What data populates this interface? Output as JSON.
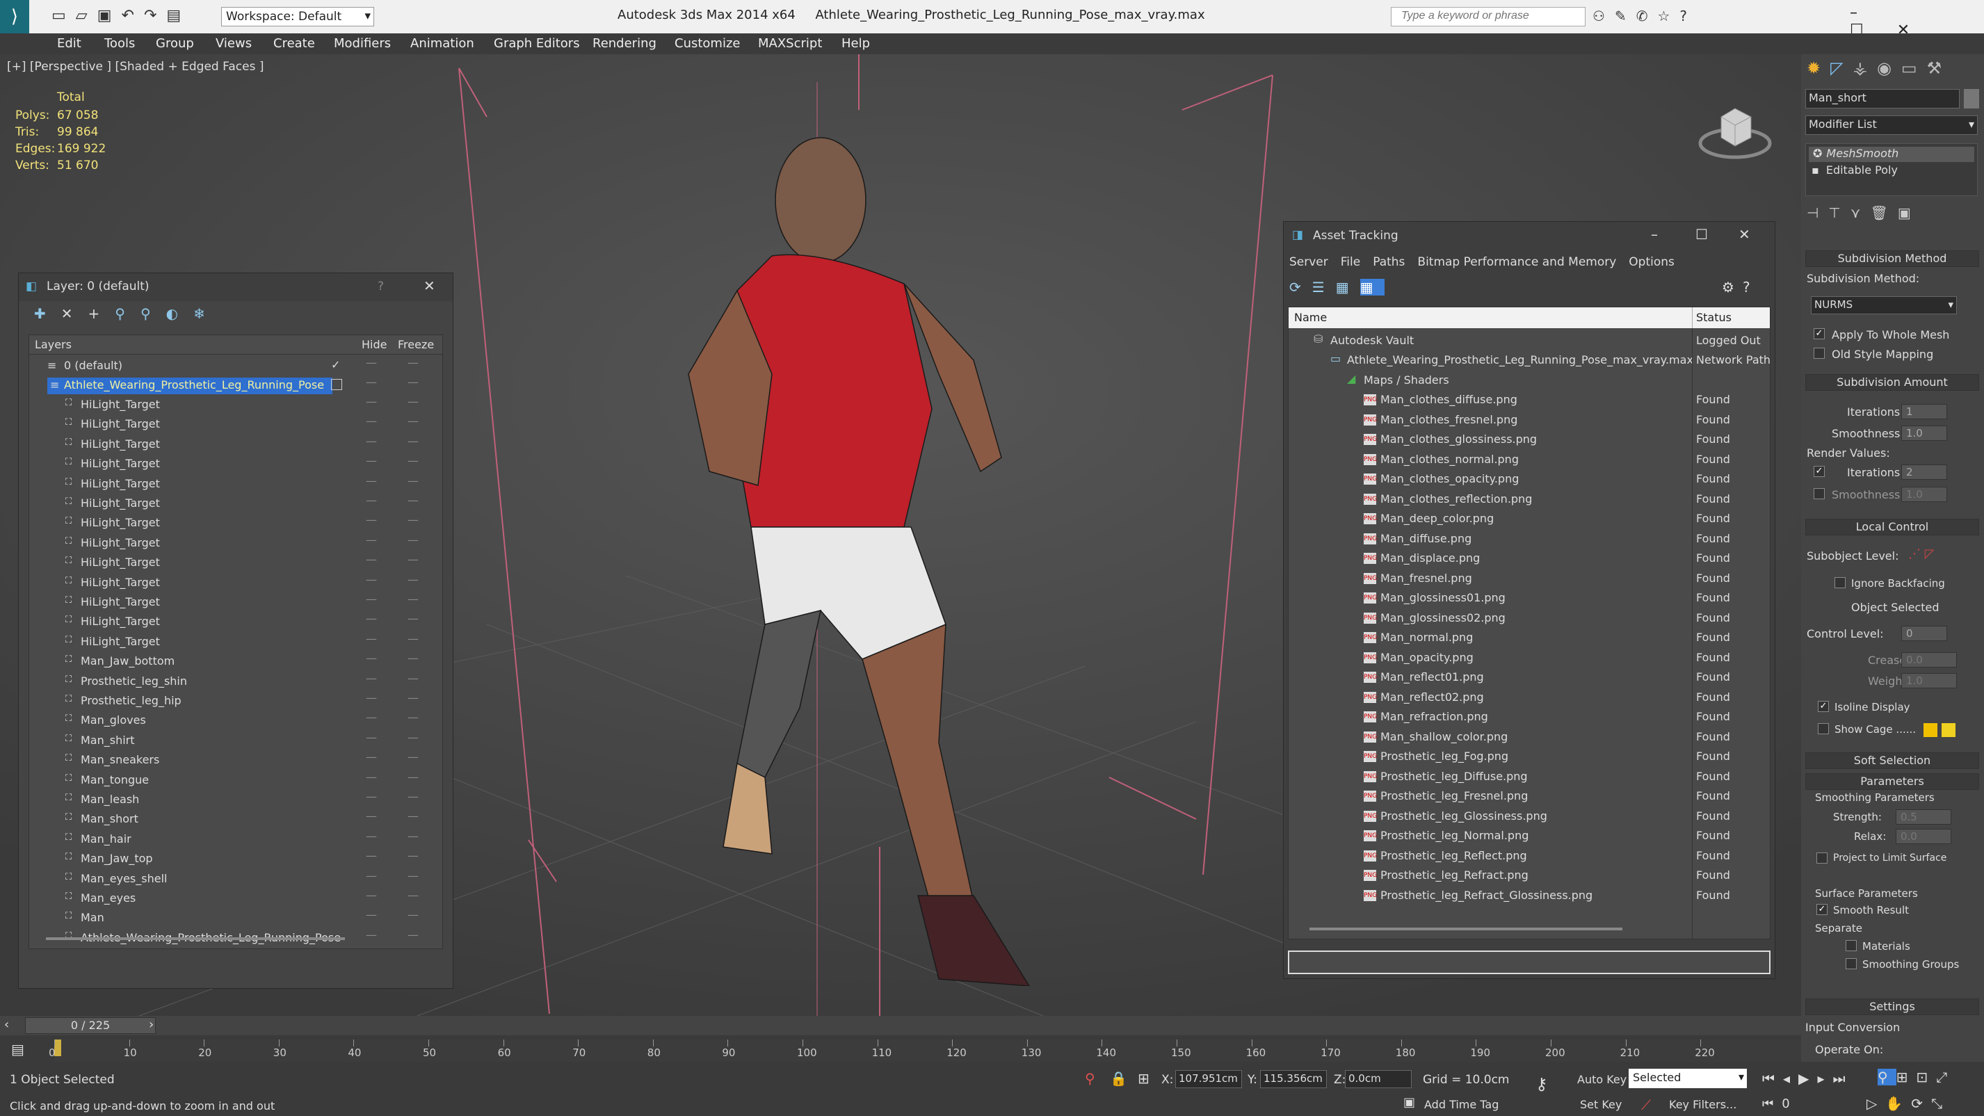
{
  "app": {
    "title": "Autodesk 3ds Max  2014 x64",
    "file": "Athlete_Wearing_Prosthetic_Leg_Running_Pose_max_vray.max",
    "workspace": "Workspace: Default",
    "search_placeholder": "Type a keyword or phrase"
  },
  "menu": [
    "Edit",
    "Tools",
    "Group",
    "Views",
    "Create",
    "Modifiers",
    "Animation",
    "Graph Editors",
    "Rendering",
    "Customize",
    "MAXScript",
    "Help"
  ],
  "viewport": {
    "label": "[+] [Perspective ] [Shaded + Edged Faces ]",
    "stats": {
      "header": "Total",
      "rows": [
        {
          "k": "Polys:",
          "v": "67 058"
        },
        {
          "k": "Tris:",
          "v": "99 864"
        },
        {
          "k": "Edges:",
          "v": "169 922"
        },
        {
          "k": "Verts:",
          "v": "51 670"
        }
      ]
    }
  },
  "layers": {
    "title": "Layer: 0 (default)",
    "help": "?",
    "cols": {
      "name": "Layers",
      "hide": "Hide",
      "freeze": "Freeze"
    },
    "default_layer": "0 (default)",
    "selected_layer": "Athlete_Wearing_Prosthetic_Leg_Running_Pose",
    "items": [
      "HiLight_Target",
      "HiLight_Target",
      "HiLight_Target",
      "HiLight_Target",
      "HiLight_Target",
      "HiLight_Target",
      "HiLight_Target",
      "HiLight_Target",
      "HiLight_Target",
      "HiLight_Target",
      "HiLight_Target",
      "HiLight_Target",
      "HiLight_Target",
      "Man_Jaw_bottom",
      "Prosthetic_leg_shin",
      "Prosthetic_leg_hip",
      "Man_gloves",
      "Man_shirt",
      "Man_sneakers",
      "Man_tongue",
      "Man_leash",
      "Man_short",
      "Man_hair",
      "Man_Jaw_top",
      "Man_eyes_shell",
      "Man_eyes",
      "Man",
      "Athlete_Wearing_Prosthetic_Leg_Running_Pose"
    ]
  },
  "asset": {
    "title": "Asset Tracking",
    "menu": [
      "Server",
      "File",
      "Paths",
      "Bitmap Performance and Memory",
      "Options"
    ],
    "cols": {
      "name": "Name",
      "status": "Status"
    },
    "vault": {
      "name": "Autodesk Vault",
      "status": "Logged Out"
    },
    "file": {
      "name": "Athlete_Wearing_Prosthetic_Leg_Running_Pose_max_vray.max",
      "status": "Network Path"
    },
    "group": "Maps / Shaders",
    "files": [
      {
        "n": "Man_clothes_diffuse.png",
        "s": "Found"
      },
      {
        "n": "Man_clothes_fresnel.png",
        "s": "Found"
      },
      {
        "n": "Man_clothes_glossiness.png",
        "s": "Found"
      },
      {
        "n": "Man_clothes_normal.png",
        "s": "Found"
      },
      {
        "n": "Man_clothes_opacity.png",
        "s": "Found"
      },
      {
        "n": "Man_clothes_reflection.png",
        "s": "Found"
      },
      {
        "n": "Man_deep_color.png",
        "s": "Found"
      },
      {
        "n": "Man_diffuse.png",
        "s": "Found"
      },
      {
        "n": "Man_displace.png",
        "s": "Found"
      },
      {
        "n": "Man_fresnel.png",
        "s": "Found"
      },
      {
        "n": "Man_glossiness01.png",
        "s": "Found"
      },
      {
        "n": "Man_glossiness02.png",
        "s": "Found"
      },
      {
        "n": "Man_normal.png",
        "s": "Found"
      },
      {
        "n": "Man_opacity.png",
        "s": "Found"
      },
      {
        "n": "Man_reflect01.png",
        "s": "Found"
      },
      {
        "n": "Man_reflect02.png",
        "s": "Found"
      },
      {
        "n": "Man_refraction.png",
        "s": "Found"
      },
      {
        "n": "Man_shallow_color.png",
        "s": "Found"
      },
      {
        "n": "Prosthetic_leg_Fog.png",
        "s": "Found"
      },
      {
        "n": "Prosthetic_leg_Diffuse.png",
        "s": "Found"
      },
      {
        "n": "Prosthetic_leg_Fresnel.png",
        "s": "Found"
      },
      {
        "n": "Prosthetic_leg_Glossiness.png",
        "s": "Found"
      },
      {
        "n": "Prosthetic_leg_Normal.png",
        "s": "Found"
      },
      {
        "n": "Prosthetic_leg_Reflect.png",
        "s": "Found"
      },
      {
        "n": "Prosthetic_leg_Refract.png",
        "s": "Found"
      },
      {
        "n": "Prosthetic_leg_Refract_Glossiness.png",
        "s": "Found"
      }
    ]
  },
  "cmd": {
    "object_name": "Man_short",
    "modifier_list": "Modifier List",
    "stack": [
      "MeshSmooth",
      "Editable Poly"
    ],
    "sub_method_hdr": "Subdivision Method",
    "sub_method_lbl": "Subdivision Method:",
    "sub_method_val": "NURMS",
    "apply_whole": "Apply To Whole Mesh",
    "old_style": "Old Style Mapping",
    "sub_amount_hdr": "Subdivision Amount",
    "iterations_lbl": "Iterations:",
    "iterations": "1",
    "smoothness_lbl": "Smoothness:",
    "smoothness": "1.0",
    "render_values": "Render Values:",
    "r_iter_lbl": "Iterations:",
    "r_iter": "2",
    "r_smooth_lbl": "Smoothness:",
    "r_smooth": "1.0",
    "local_hdr": "Local Control",
    "subobj_lbl": "Subobject Level:",
    "ignore_bf": "Ignore Backfacing",
    "obj_selected": "Object Selected",
    "ctrl_lvl_lbl": "Control Level:",
    "ctrl_lvl": "0",
    "crease_lbl": "Crease:",
    "crease": "0.0",
    "weight_lbl": "Weight:",
    "weight": "1.0",
    "isoline": "Isoline Display",
    "showcage": "Show Cage ......",
    "soft_hdr": "Soft Selection",
    "params_hdr": "Parameters",
    "smooth_params": "Smoothing Parameters",
    "strength_lbl": "Strength:",
    "strength": "0.5",
    "relax_lbl": "Relax:",
    "relax": "0.0",
    "project": "Project to Limit Surface",
    "surface_params": "Surface Parameters",
    "smooth_result": "Smooth Result",
    "separate": "Separate",
    "materials": "Materials",
    "smoothing_groups": "Smoothing Groups",
    "settings_hdr": "Settings",
    "input_conv": "Input Conversion",
    "operate_on": "Operate On:"
  },
  "timeline": {
    "frame": "0 / 225",
    "ticks": [
      "0",
      "10",
      "20",
      "30",
      "40",
      "50",
      "60",
      "70",
      "80",
      "90",
      "100",
      "110",
      "120",
      "130",
      "140",
      "150",
      "160",
      "170",
      "180",
      "190",
      "200",
      "210",
      "220"
    ]
  },
  "status": {
    "selected": "1 Object Selected",
    "hint": "Click and drag up-and-down to zoom in and out",
    "x_lbl": "X:",
    "x": "107.951cm",
    "y_lbl": "Y:",
    "y": "115.356cm",
    "z_lbl": "Z:",
    "z": "0.0cm",
    "grid": "Grid = 10.0cm",
    "autokey": "Auto Key",
    "setkey": "Set Key",
    "selected_dd": "Selected",
    "keyfilters": "Key Filters...",
    "addtimetag": "Add Time Tag",
    "frame": "0"
  },
  "colors": {
    "accent": "#3c7fd8",
    "select": "#2f6fd0",
    "stats": "#f2e27a",
    "box": "#c0607a"
  }
}
